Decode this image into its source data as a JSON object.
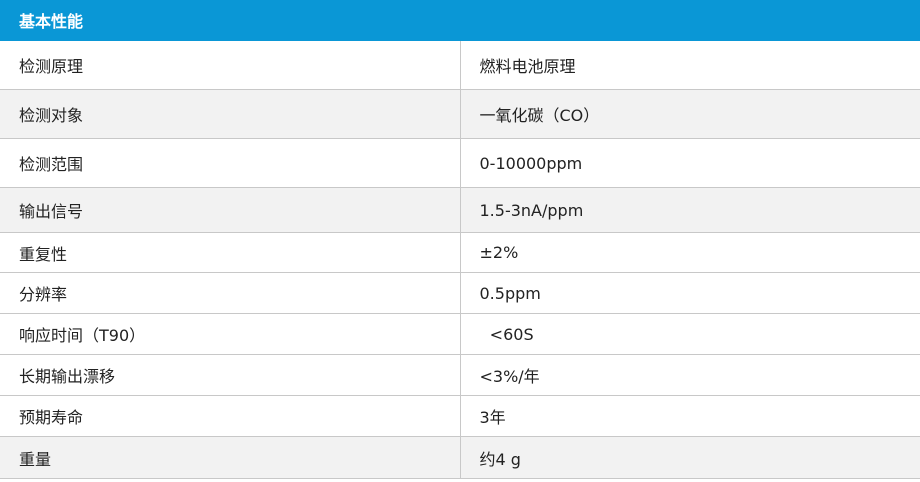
{
  "header": {
    "title": "基本性能"
  },
  "rows": [
    {
      "label": "检测原理",
      "value": "燃料电池原理"
    },
    {
      "label": "检测对象",
      "value": "一氧化碳（CO）"
    },
    {
      "label": "检测范围",
      "value": "0-10000ppm"
    },
    {
      "label": "输出信号",
      "value": "1.5-3nA/ppm"
    },
    {
      "label": "重复性",
      "value": "±2%"
    },
    {
      "label": "分辨率",
      "value": "0.5ppm"
    },
    {
      "label": "响应时间（T90）",
      "value": "  <60S"
    },
    {
      "label": "长期输出漂移",
      "value": "<3%/年"
    },
    {
      "label": "预期寿命",
      "value": "3年"
    },
    {
      "label": "重量",
      "value": "约4 g"
    }
  ],
  "colors": {
    "header_bg": "#0a97d6",
    "header_text": "#ffffff",
    "row_alt_bg": "#f2f2f2",
    "border": "#c8c8c8"
  }
}
